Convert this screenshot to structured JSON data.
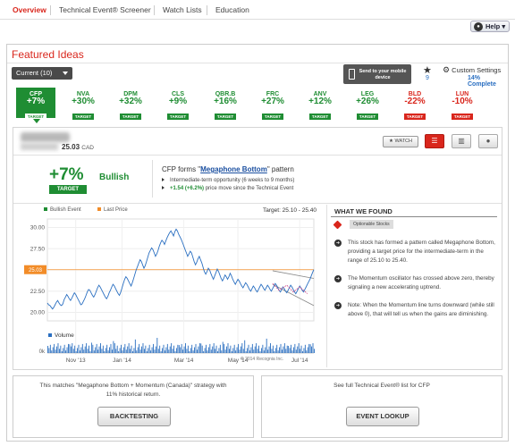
{
  "nav": {
    "tabs": [
      "Overview",
      "Technical Event® Screener",
      "Watch Lists",
      "Education"
    ],
    "help_label": "Help",
    "help_caret": "▾"
  },
  "panel": {
    "title": "Featured Ideas",
    "dropdown_label": "Current (10)",
    "send_label_1": "Send to your mobile",
    "send_label_2": "device",
    "star_count": "9",
    "custom_settings": "Custom Settings",
    "complete_pct": "14% Complete"
  },
  "ideas": [
    {
      "symbol": "CFP",
      "pct": "+7%",
      "tag": "TARGET",
      "direction": "up",
      "selected": true
    },
    {
      "symbol": "NVA",
      "pct": "+30%",
      "tag": "TARGET",
      "direction": "up",
      "selected": false
    },
    {
      "symbol": "DPM",
      "pct": "+32%",
      "tag": "TARGET",
      "direction": "up",
      "selected": false
    },
    {
      "symbol": "CLS",
      "pct": "+9%",
      "tag": "TARGET",
      "direction": "up",
      "selected": false
    },
    {
      "symbol": "QBR.B",
      "pct": "+16%",
      "tag": "TARGET",
      "direction": "up",
      "selected": false
    },
    {
      "symbol": "FRC",
      "pct": "+27%",
      "tag": "TARGET",
      "direction": "up",
      "selected": false
    },
    {
      "symbol": "ANV",
      "pct": "+12%",
      "tag": "TARGET",
      "direction": "up",
      "selected": false
    },
    {
      "symbol": "LEG",
      "pct": "+26%",
      "tag": "TARGET",
      "direction": "up",
      "selected": false
    },
    {
      "symbol": "BLD",
      "pct": "-22%",
      "tag": "TARGET",
      "direction": "down",
      "selected": false
    },
    {
      "symbol": "LUN",
      "pct": "-10%",
      "tag": "TARGET",
      "direction": "down",
      "selected": false
    }
  ],
  "detail": {
    "price": "25.03",
    "currency": "CAD",
    "watch_label": "WATCH",
    "big_pct": "+7%",
    "big_target": "TARGET",
    "sentiment": "Bullish",
    "pattern_prefix": "CFP forms \"",
    "pattern_name": "Megaphone Bottom",
    "pattern_suffix": "\" pattern",
    "bullet1": "Intermediate-term opportunity (6 weeks to 9 months)",
    "bullet2_highlight": "+1.54 (+6.2%)",
    "bullet2_rest": " price move since the Technical Event"
  },
  "chart": {
    "legend_event": "Bullish Event",
    "legend_last": "Last Price",
    "target_label": "Target: 25.10 - 25.40",
    "volume_label": "Volume",
    "copyright": "© 2014 Recognia Inc.",
    "last_price_tag": "25.03",
    "event_color": "#1f8d33",
    "last_color": "#f28c28",
    "line_color": "#2a6fc1"
  },
  "chart_data": {
    "type": "line",
    "title": "",
    "xlabel": "",
    "ylabel": "",
    "ylim": [
      19,
      31
    ],
    "yticks": [
      "30.00",
      "27.50",
      "25.00",
      "22.50",
      "20.00"
    ],
    "ytick_values": [
      30,
      27.5,
      25,
      22.5,
      20
    ],
    "xticks": [
      "Nov '13",
      "Jan '14",
      "Mar '14",
      "May '14",
      "Jul '14"
    ],
    "xtick_index": [
      22,
      58,
      106,
      148,
      196
    ],
    "last_price": 25.03,
    "target_range": [
      25.1,
      25.4
    ],
    "series": [
      {
        "values": [
          21.1,
          20.9,
          20.8,
          20.6,
          20.4,
          20.6,
          20.9,
          21.2,
          21.4,
          21.1,
          20.9,
          20.8,
          21.0,
          21.5,
          21.8,
          22.1,
          21.9,
          21.6,
          21.4,
          21.7,
          22.0,
          22.3,
          22.1,
          21.8,
          21.5,
          21.2,
          20.9,
          21.0,
          21.3,
          21.6,
          22.0,
          22.4,
          22.7,
          22.6,
          22.3,
          22.0,
          21.8,
          22.1,
          22.5,
          22.9,
          23.2,
          23.0,
          22.7,
          22.4,
          22.1,
          21.8,
          21.6,
          21.9,
          22.3,
          22.6,
          23.0,
          23.3,
          23.1,
          22.8,
          22.5,
          22.2,
          22.0,
          22.4,
          22.9,
          23.4,
          23.9,
          24.2,
          24.0,
          23.7,
          23.4,
          23.1,
          23.5,
          24.0,
          24.5,
          25.0,
          25.4,
          25.8,
          26.2,
          26.0,
          25.6,
          25.2,
          25.5,
          26.0,
          26.5,
          27.0,
          27.3,
          27.6,
          27.4,
          27.0,
          26.6,
          26.9,
          27.3,
          27.8,
          28.2,
          28.5,
          28.3,
          28.0,
          28.4,
          28.8,
          29.1,
          29.4,
          29.6,
          29.3,
          29.0,
          29.5,
          29.8,
          29.6,
          29.2,
          28.9,
          28.6,
          28.2,
          27.8,
          27.4,
          27.0,
          26.6,
          26.9,
          27.2,
          27.0,
          26.5,
          26.0,
          25.6,
          25.9,
          26.3,
          26.6,
          26.2,
          25.8,
          25.3,
          24.8,
          24.5,
          24.8,
          25.2,
          25.0,
          24.6,
          24.2,
          23.9,
          24.3,
          24.7,
          25.1,
          24.8,
          24.4,
          24.0,
          23.7,
          24.0,
          24.4,
          24.2,
          23.9,
          24.2,
          24.6,
          24.3,
          23.9,
          23.6,
          23.3,
          23.6,
          23.9,
          23.7,
          23.4,
          23.1,
          22.9,
          23.2,
          23.5,
          23.3,
          23.0,
          22.7,
          22.5,
          22.8,
          23.1,
          22.9,
          22.6,
          22.4,
          22.7,
          23.0,
          23.3,
          23.1,
          22.8,
          22.6,
          22.9,
          23.2,
          23.0,
          22.7,
          22.5,
          22.8,
          23.1,
          23.4,
          23.2,
          22.9,
          22.6,
          22.4,
          22.7,
          23.0,
          22.8,
          22.5,
          22.3,
          22.6,
          22.9,
          23.2,
          23.0,
          22.7,
          22.4,
          22.2,
          22.5,
          22.8,
          23.1,
          22.9,
          22.6,
          22.4,
          22.7,
          23.0,
          23.3,
          23.6,
          23.9,
          24.3,
          24.7,
          25.03
        ]
      }
    ],
    "event_index": 219
  },
  "whatwefound": {
    "title": "WHAT WE FOUND",
    "chip": "Optionable Stocks",
    "note1": "This stock has formed a pattern called Megaphone Bottom, providing a target price for the intermediate-term in the range of 25.10 to 25.40.",
    "note2": "The Momentum oscillator has crossed above zero, thereby signaling a new accelerating uptrend.",
    "note3": "Note: When the Momentum line turns downward (while still above 0), that will tell us when the gains are diminishing."
  },
  "bottom": {
    "left_text_1": "This matches \"Megaphone Bottom + Momentum (Canada)\" strategy with",
    "left_text_2": "11% historical return.",
    "left_button": "BACKTESTING",
    "right_text": "See full Technical Event® list for CFP",
    "right_button": "EVENT LOOKUP"
  }
}
